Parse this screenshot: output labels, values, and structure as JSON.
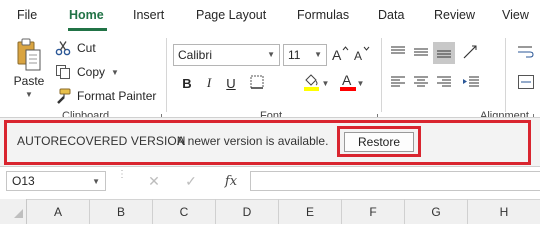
{
  "tabs": [
    {
      "label": "File"
    },
    {
      "label": "Home"
    },
    {
      "label": "Insert"
    },
    {
      "label": "Page Layout"
    },
    {
      "label": "Formulas"
    },
    {
      "label": "Data"
    },
    {
      "label": "Review"
    },
    {
      "label": "View"
    }
  ],
  "active_tab": "Home",
  "accent_color": "#217346",
  "highlight_color": "#d9252f",
  "clipboard": {
    "paste": "Paste",
    "cut": "Cut",
    "copy": "Copy",
    "format_painter": "Format Painter",
    "group_label": "Clipboard"
  },
  "font": {
    "name": "Calibri",
    "size": "11",
    "group_label": "Font",
    "fill_color": "#ffff00",
    "font_color": "#ff0000"
  },
  "alignment": {
    "group_label": "Alignment"
  },
  "message_bar": {
    "title": "AUTORECOVERED VERSION",
    "text": "A newer version is available.",
    "button": "Restore"
  },
  "formula_bar": {
    "name_box": "O13",
    "fx": "fx",
    "value": ""
  },
  "columns": [
    "A",
    "B",
    "C",
    "D",
    "E",
    "F",
    "G",
    "H"
  ]
}
